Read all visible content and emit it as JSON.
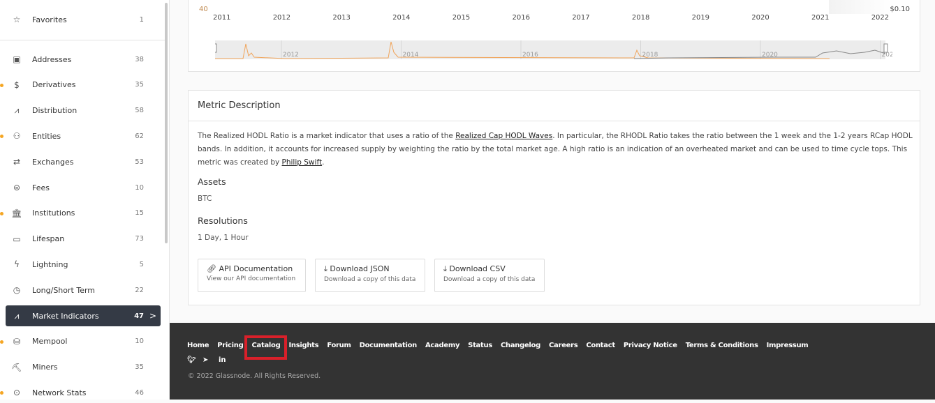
{
  "sidebar": {
    "favorites": {
      "label": "Favorites",
      "count": "1",
      "icon": "star-icon"
    },
    "items": [
      {
        "label": "Addresses",
        "count": "38",
        "icon": "wallet-icon",
        "dot": false
      },
      {
        "label": "Derivatives",
        "count": "35",
        "icon": "derivatives-icon",
        "dot": true
      },
      {
        "label": "Distribution",
        "count": "58",
        "icon": "distribution-icon",
        "dot": false
      },
      {
        "label": "Entities",
        "count": "62",
        "icon": "users-icon",
        "dot": true
      },
      {
        "label": "Exchanges",
        "count": "53",
        "icon": "exchange-icon",
        "dot": false
      },
      {
        "label": "Fees",
        "count": "10",
        "icon": "fees-icon",
        "dot": false
      },
      {
        "label": "Institutions",
        "count": "15",
        "icon": "bank-icon",
        "dot": true
      },
      {
        "label": "Lifespan",
        "count": "73",
        "icon": "calendar-icon",
        "dot": false
      },
      {
        "label": "Lightning",
        "count": "5",
        "icon": "lightning-icon",
        "dot": false
      },
      {
        "label": "Long/Short Term",
        "count": "22",
        "icon": "clock-icon",
        "dot": false
      },
      {
        "label": "Market Indicators",
        "count": "47",
        "icon": "chart-line-icon",
        "dot": false,
        "active": true
      },
      {
        "label": "Mempool",
        "count": "10",
        "icon": "database-icon",
        "dot": true
      },
      {
        "label": "Miners",
        "count": "35",
        "icon": "pickaxe-icon",
        "dot": false
      },
      {
        "label": "Network Stats",
        "count": "46",
        "icon": "network-icon",
        "dot": true
      }
    ]
  },
  "chart": {
    "y_left_label": "40",
    "y_right_label": "$0.10",
    "x_ticks": [
      "2011",
      "2012",
      "2013",
      "2014",
      "2015",
      "2016",
      "2017",
      "2018",
      "2019",
      "2020",
      "2021",
      "2022"
    ],
    "navigator_ticks": [
      "2012",
      "2014",
      "2016",
      "2018",
      "2020",
      "2022"
    ],
    "colors": {
      "series": "#f0a45a",
      "price": "#888888"
    }
  },
  "metric": {
    "title": "Metric Description",
    "desc_1": "The Realized HODL Ratio is a market indicator that uses a ratio of the ",
    "link_1": "Realized Cap HODL Waves",
    "desc_2": ". In particular, the RHODL Ratio takes the ratio between the 1 week and the 1-2 years RCap HODL bands. In addition, it accounts for increased supply by weighting the ratio by the total market age. A high ratio is an indication of an overheated market and can be used to time cycle tops. This metric was created by ",
    "link_2": "Philip Swift",
    "desc_3": ".",
    "assets_heading": "Assets",
    "assets": "BTC",
    "res_heading": "Resolutions",
    "resolutions": "1 Day, 1 Hour",
    "buttons": [
      {
        "title": "API Documentation",
        "sub": "View our API documentation"
      },
      {
        "title": "Download JSON",
        "sub": "Download a copy of this data"
      },
      {
        "title": "Download CSV",
        "sub": "Download a copy of this data"
      }
    ]
  },
  "footer": {
    "links": [
      "Home",
      "Pricing",
      "Catalog",
      "Insights",
      "Forum",
      "Documentation",
      "Academy",
      "Status",
      "Changelog",
      "Careers",
      "Contact",
      "Privacy Notice",
      "Terms & Conditions",
      "Impressum"
    ],
    "copyright": "© 2022 Glassnode. All Rights Reserved.",
    "highlight_color": "#d9202a"
  }
}
